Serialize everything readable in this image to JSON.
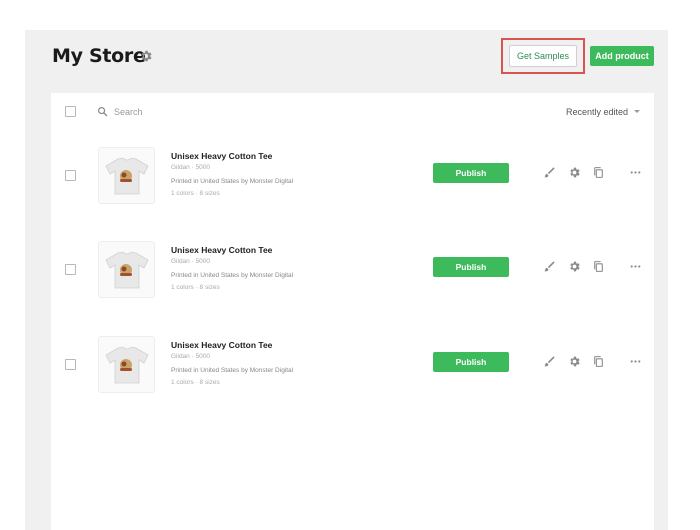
{
  "page": {
    "title": "My Store",
    "title_icon": "gear-icon"
  },
  "header": {
    "get_samples_label": "Get Samples",
    "add_product_label": "Add product",
    "highlight_color": "#d9534f",
    "accent_color": "#3dba5c"
  },
  "toolbar": {
    "search_placeholder": "Search",
    "search_value": "",
    "sort_label": "Recently edited",
    "sort_icon": "chevron-down-icon"
  },
  "products": [
    {
      "name": "Unisex Heavy Cotton Tee",
      "brand": "Gildan · 5000",
      "print_info": "Printed in United States by Monster Digital",
      "variants": "1 colors · 8 sizes",
      "publish_label": "Publish",
      "actions": [
        "edit-icon",
        "gear-icon",
        "copy-icon",
        "more-icon"
      ]
    },
    {
      "name": "Unisex Heavy Cotton Tee",
      "brand": "Gildan · 5000",
      "print_info": "Printed in United States by Monster Digital",
      "variants": "1 colors · 8 sizes",
      "publish_label": "Publish",
      "actions": [
        "edit-icon",
        "gear-icon",
        "copy-icon",
        "more-icon"
      ]
    },
    {
      "name": "Unisex Heavy Cotton Tee",
      "brand": "Gildan · 5000",
      "print_info": "Printed in United States by Monster Digital",
      "variants": "1 colors · 8 sizes",
      "publish_label": "Publish",
      "actions": [
        "edit-icon",
        "gear-icon",
        "copy-icon",
        "more-icon"
      ]
    }
  ]
}
